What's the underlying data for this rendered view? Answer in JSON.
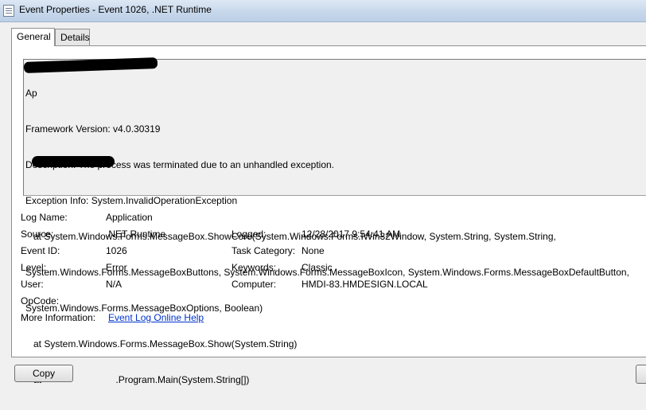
{
  "window": {
    "title": "Event Properties - Event 1026, .NET Runtime"
  },
  "tabs": [
    {
      "label": "General",
      "active": true
    },
    {
      "label": "Details",
      "active": false
    }
  ],
  "description": {
    "lines": [
      "Ap",
      "Framework Version: v4.0.30319",
      "Description: The process was terminated due to an unhandled exception.",
      "Exception Info: System.InvalidOperationException",
      "   at System.Windows.Forms.MessageBox.ShowCore(System.Windows.Forms.IWin32Window, System.String, System.String,",
      "System.Windows.Forms.MessageBoxButtons, System.Windows.Forms.MessageBoxIcon, System.Windows.Forms.MessageBoxDefaultButton,",
      "System.Windows.Forms.MessageBoxOptions, Boolean)",
      "   at System.Windows.Forms.MessageBox.Show(System.String)",
      "   at                            .Program.Main(System.String[])"
    ]
  },
  "fields": {
    "log_name": {
      "label": "Log Name:",
      "value": "Application"
    },
    "source": {
      "label": "Source:",
      "value": ".NET Runtime"
    },
    "logged": {
      "label": "Logged:",
      "value": "12/28/2017 9:54:41 AM"
    },
    "event_id": {
      "label": "Event ID:",
      "value": "1026"
    },
    "task_category": {
      "label": "Task Category:",
      "value": "None"
    },
    "level": {
      "label": "Level:",
      "value": "Error"
    },
    "keywords": {
      "label": "Keywords:",
      "value": "Classic"
    },
    "user": {
      "label": "User:",
      "value": "N/A"
    },
    "computer": {
      "label": "Computer:",
      "value": "HMDI-83.HMDESIGN.LOCAL"
    },
    "opcode": {
      "label": "OpCode:",
      "value": ""
    },
    "more_information": {
      "label": "More Information:",
      "value": "Event Log Online Help"
    }
  },
  "buttons": {
    "copy_label": "Copy"
  }
}
